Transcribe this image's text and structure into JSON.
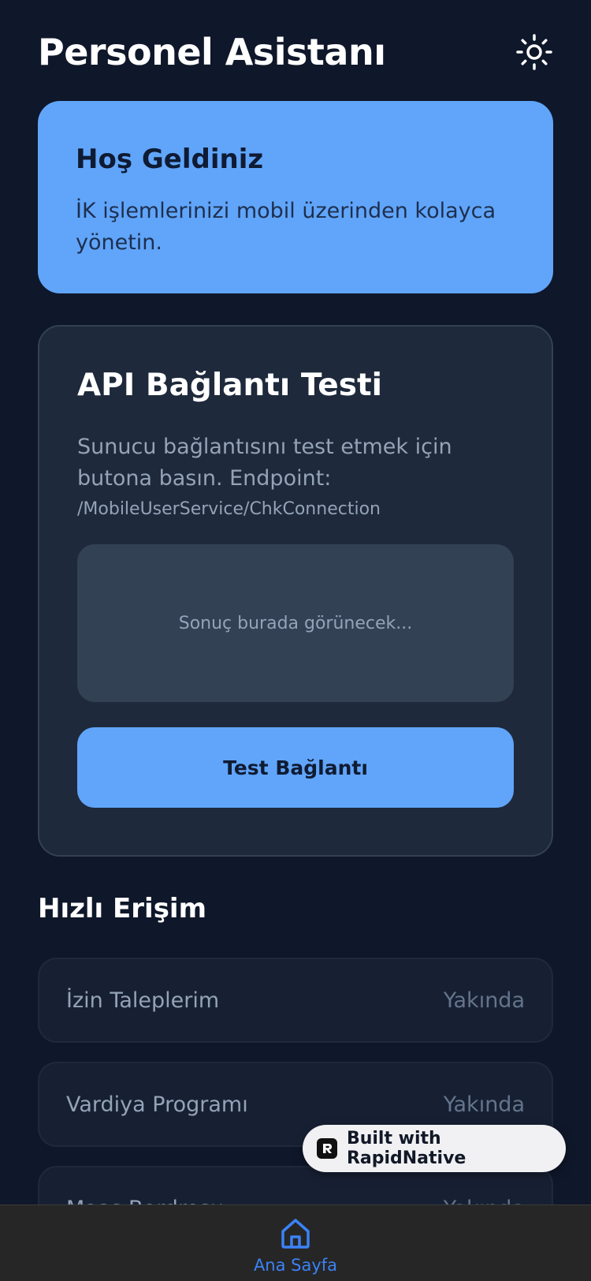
{
  "header": {
    "title": "Personel Asistanı",
    "theme_icon": "sun-icon"
  },
  "welcome": {
    "title": "Hoş Geldiniz",
    "text": "İK işlemlerinizi mobil üzerinden kolayca yönetin."
  },
  "api_test": {
    "title": "API Bağlantı Testi",
    "description": "Sunucu bağlantısını test etmek için butona basın. Endpoint:",
    "endpoint": "/MobileUserService/ChkConnection",
    "result_placeholder": "Sonuç burada görünecek...",
    "button_label": "Test Bağlantı"
  },
  "quick_access": {
    "title": "Hızlı Erişim",
    "items": [
      {
        "label": "İzin Taleplerim",
        "status": "Yakında"
      },
      {
        "label": "Vardiya Programı",
        "status": "Yakında"
      },
      {
        "label": "Maaş Bordrosu",
        "status": "Yakında"
      }
    ]
  },
  "badge": {
    "text": "Built with RapidNative",
    "icon": "rapidnative-logo-icon"
  },
  "bottom_nav": {
    "home_label": "Ana Sayfa",
    "home_icon": "home-icon"
  },
  "colors": {
    "background": "#0f172a",
    "accent": "#60a5fa",
    "card": "#1e293b",
    "nav_active": "#3b82f6"
  }
}
